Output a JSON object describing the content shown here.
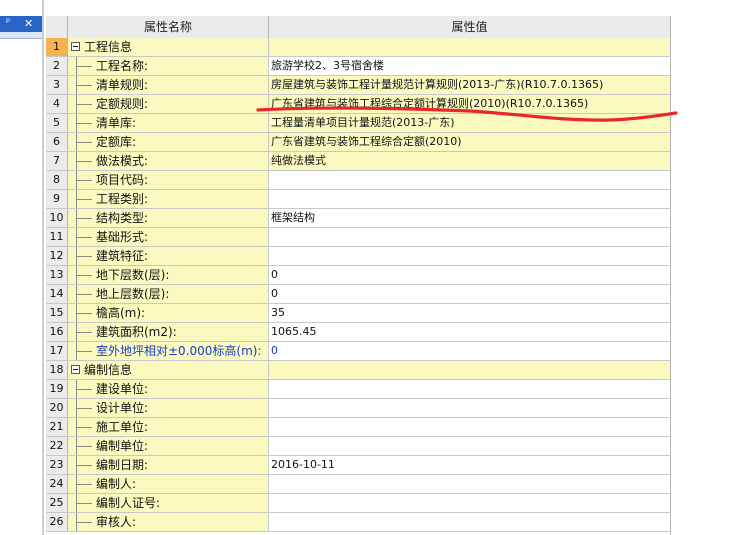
{
  "panel": {
    "pin_icon": "pin-icon",
    "close_icon": "close-icon"
  },
  "grid": {
    "header": {
      "name": "属性名称",
      "value": "属性值"
    },
    "rows": [
      {
        "num": "1",
        "label": "工程信息",
        "value": "",
        "type": "group"
      },
      {
        "num": "2",
        "label": "工程名称:",
        "value": "旅游学校2、3号宿舍楼",
        "type": "child",
        "highlight": false
      },
      {
        "num": "3",
        "label": "清单规则:",
        "value": "房屋建筑与装饰工程计量规范计算规则(2013-广东)(R10.7.0.1365)",
        "type": "child",
        "highlight": true
      },
      {
        "num": "4",
        "label": "定额规则:",
        "value": "广东省建筑与装饰工程综合定额计算规则(2010)(R10.7.0.1365)",
        "type": "child",
        "highlight": true
      },
      {
        "num": "5",
        "label": "清单库:",
        "value": "工程量清单项目计量规范(2013-广东)",
        "type": "child",
        "highlight": true
      },
      {
        "num": "6",
        "label": "定额库:",
        "value": "广东省建筑与装饰工程综合定额(2010)",
        "type": "child",
        "highlight": true
      },
      {
        "num": "7",
        "label": "做法模式:",
        "value": "纯做法模式",
        "type": "child",
        "highlight": true
      },
      {
        "num": "8",
        "label": "项目代码:",
        "value": "",
        "type": "child",
        "highlight": false
      },
      {
        "num": "9",
        "label": "工程类别:",
        "value": "",
        "type": "child",
        "highlight": false
      },
      {
        "num": "10",
        "label": "结构类型:",
        "value": "框架结构",
        "type": "child",
        "highlight": false
      },
      {
        "num": "11",
        "label": "基础形式:",
        "value": "",
        "type": "child",
        "highlight": false
      },
      {
        "num": "12",
        "label": "建筑特征:",
        "value": "",
        "type": "child",
        "highlight": false
      },
      {
        "num": "13",
        "label": "地下层数(层):",
        "value": "0",
        "type": "child",
        "highlight": false
      },
      {
        "num": "14",
        "label": "地上层数(层):",
        "value": "0",
        "type": "child",
        "highlight": false
      },
      {
        "num": "15",
        "label": "檐高(m):",
        "value": "35",
        "type": "child",
        "highlight": false
      },
      {
        "num": "16",
        "label": "建筑面积(m2):",
        "value": "1065.45",
        "type": "child",
        "highlight": false
      },
      {
        "num": "17",
        "label": "室外地坪相对±0.000标高(m):",
        "value": "0",
        "type": "child",
        "highlight": false,
        "blue": true
      },
      {
        "num": "18",
        "label": "编制信息",
        "value": "",
        "type": "group"
      },
      {
        "num": "19",
        "label": "建设单位:",
        "value": "",
        "type": "child",
        "highlight": false
      },
      {
        "num": "20",
        "label": "设计单位:",
        "value": "",
        "type": "child",
        "highlight": false
      },
      {
        "num": "21",
        "label": "施工单位:",
        "value": "",
        "type": "child",
        "highlight": false
      },
      {
        "num": "22",
        "label": "编制单位:",
        "value": "",
        "type": "child",
        "highlight": false
      },
      {
        "num": "23",
        "label": "编制日期:",
        "value": "2016-10-11",
        "type": "child",
        "highlight": false
      },
      {
        "num": "24",
        "label": "编制人:",
        "value": "",
        "type": "child",
        "highlight": false
      },
      {
        "num": "25",
        "label": "编制人证号:",
        "value": "",
        "type": "child",
        "highlight": false
      },
      {
        "num": "26",
        "label": "审核人:",
        "value": "",
        "type": "child",
        "highlight": false
      }
    ],
    "selected_row": "1"
  },
  "annotation": {
    "stroke_color": "#e8262b"
  }
}
